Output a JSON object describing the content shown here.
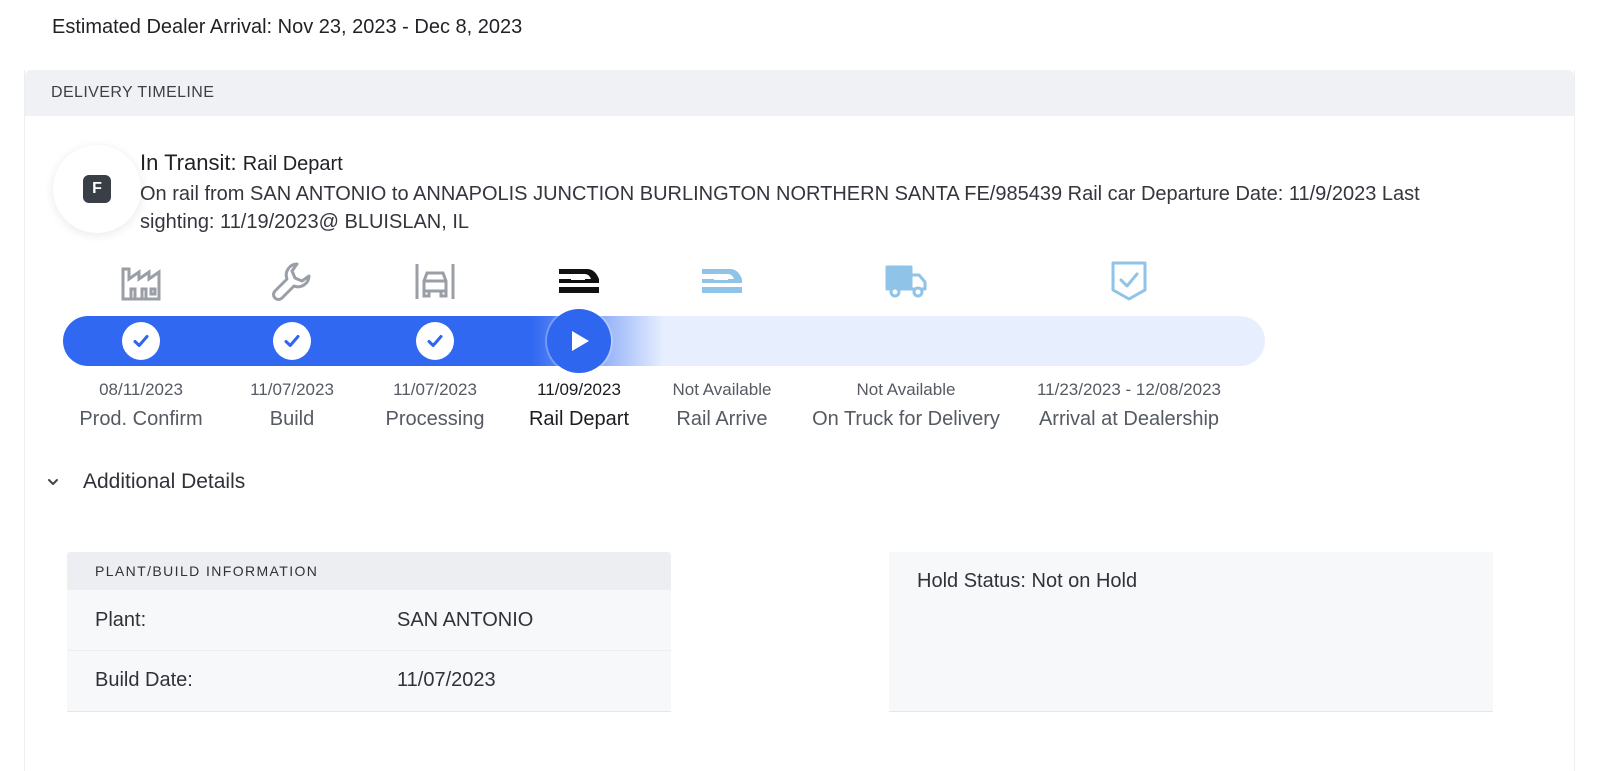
{
  "eta": "Estimated Dealer Arrival: Nov 23, 2023 - Dec 8, 2023",
  "timeline": {
    "header": "DELIVERY TIMELINE",
    "status_letter": "F",
    "status_title": "In Transit:",
    "status_subtitle": "Rail Depart",
    "status_description": "On rail from SAN ANTONIO to ANNAPOLIS JUNCTION BURLINGTON NORTHERN SANTA FE/985439 Rail car Departure Date: 11/9/2023 Last sighting: 11/19/2023@ BLUISLAN, IL",
    "colors": {
      "active": "#3168f2",
      "inactive_track": "#e7efff",
      "done_icon": "#9a9ea6",
      "future_icon": "#8fc3e8",
      "current_icon": "#111111"
    },
    "stages": [
      {
        "icon": "factory-icon",
        "date": "08/11/2023",
        "label": "Prod. Confirm",
        "state": "done"
      },
      {
        "icon": "wrench-icon",
        "date": "11/07/2023",
        "label": "Build",
        "state": "done"
      },
      {
        "icon": "car-bay-icon",
        "date": "11/07/2023",
        "label": "Processing",
        "state": "done"
      },
      {
        "icon": "train-icon",
        "date": "11/09/2023",
        "label": "Rail Depart",
        "state": "current"
      },
      {
        "icon": "train-icon",
        "date": "Not Available",
        "label": "Rail Arrive",
        "state": "future"
      },
      {
        "icon": "truck-icon",
        "date": "Not Available",
        "label": "On Truck for Delivery",
        "state": "future"
      },
      {
        "icon": "shield-check-icon",
        "date": "11/23/2023 - 12/08/2023",
        "label": "Arrival at Dealership",
        "state": "future"
      }
    ]
  },
  "details": {
    "toggle_label": "Additional Details",
    "plant": {
      "header": "PLANT/BUILD INFORMATION",
      "rows": [
        {
          "key": "Plant:",
          "value": "SAN ANTONIO"
        },
        {
          "key": "Build Date:",
          "value": "11/07/2023"
        }
      ]
    },
    "hold_status": "Hold Status: Not on Hold"
  }
}
